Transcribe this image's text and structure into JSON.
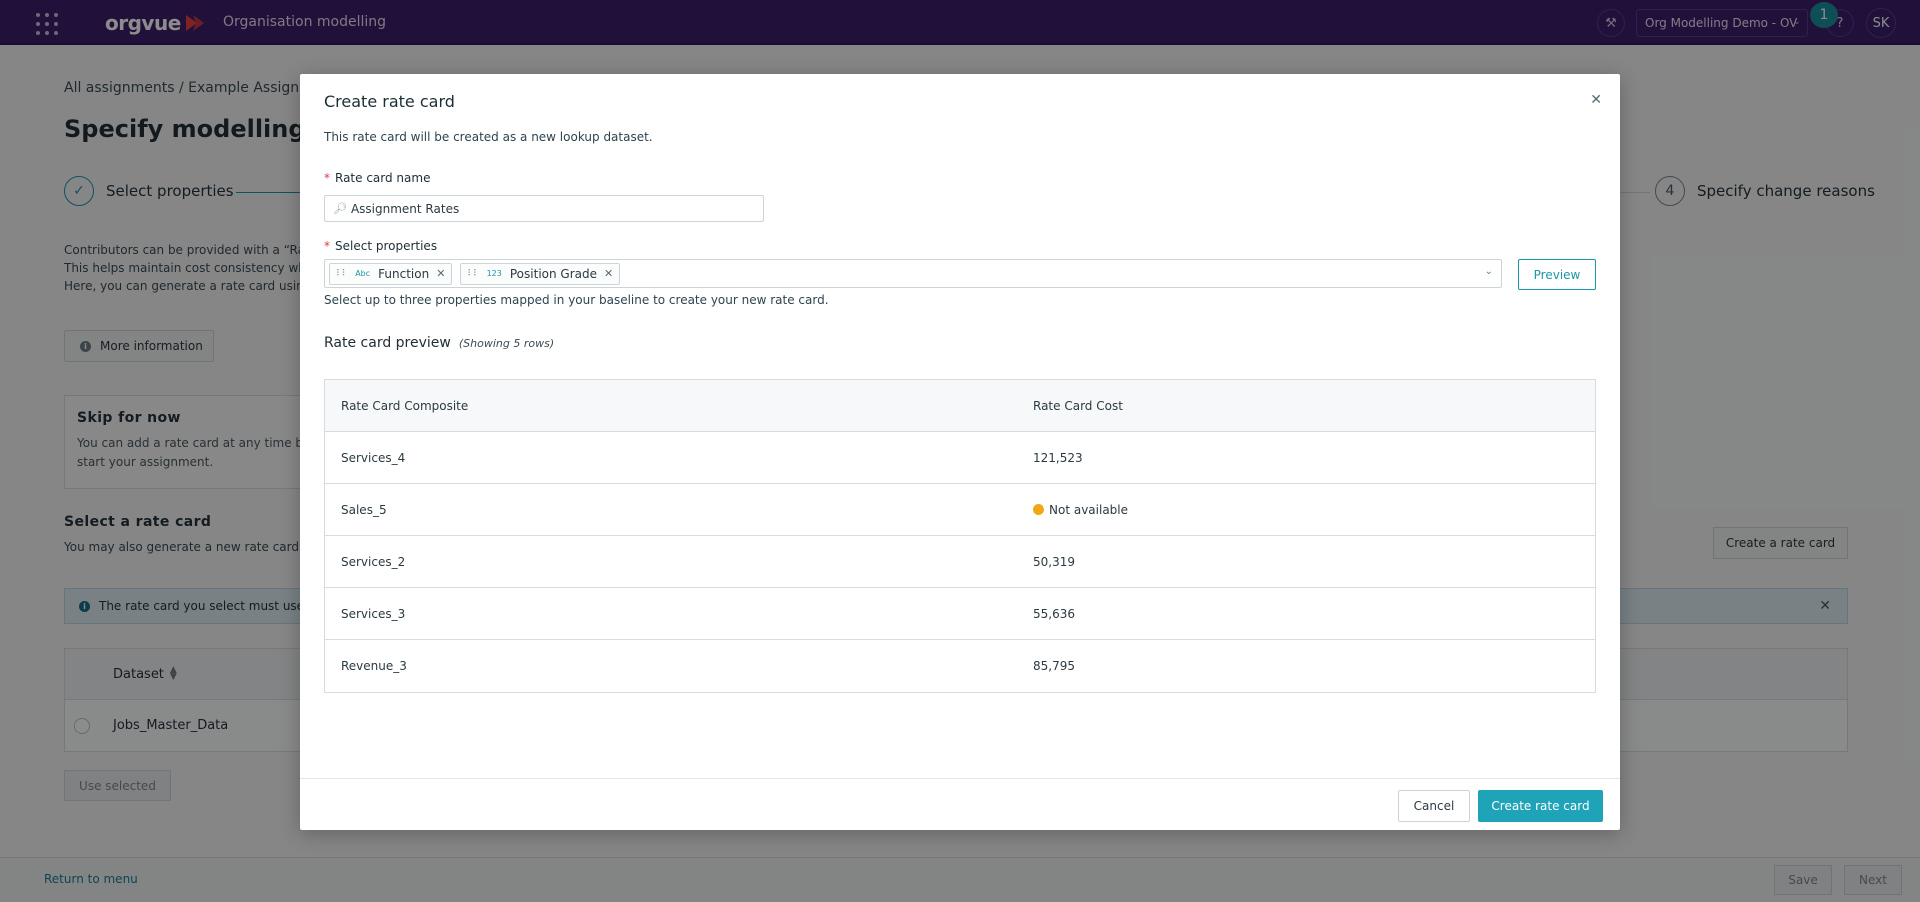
{
  "topbar": {
    "logo_text": "orgvue",
    "app_title": "Organisation modelling",
    "dataset_selector": "Org Modelling Demo - OV",
    "notification_count": "1",
    "help_label": "?",
    "user_initials": "SK",
    "accent_color": "#3d1f6b"
  },
  "page": {
    "breadcrumb": "All assignments / Example Assignm",
    "title": "Specify modelling p",
    "step1_label": "Select properties",
    "step4_number": "4",
    "step4_label": "Specify change reasons",
    "intro_lines": [
      "Contributors can be provided with a “Rate",
      "This helps maintain cost consistency whe",
      "Here, you can generate a rate card using"
    ],
    "more_info_label": "More information",
    "skip_title": "Skip for now",
    "skip_text_1": "You can add a rate card at any time bef",
    "skip_text_2": "start your assignment.",
    "select_rc_title": "Select a rate card",
    "select_rc_sub": "You may also generate a new rate card fr",
    "create_rc_label": "Create a rate card",
    "notice_text": "The rate card you select must use",
    "dataset_col": "Dataset",
    "dataset_row": "Jobs_Master_Data",
    "use_selected_label": "Use selected"
  },
  "footer": {
    "return_label": "Return to menu",
    "save_label": "Save",
    "next_label": "Next"
  },
  "modal": {
    "title": "Create rate card",
    "description": "This rate card will be created as a new lookup dataset.",
    "name_label": "Rate card name",
    "name_value": "Assignment Rates",
    "props_label": "Select properties",
    "chips": [
      {
        "type": "Abc",
        "label": "Function"
      },
      {
        "type": "123",
        "label": "Position Grade"
      }
    ],
    "preview_label": "Preview",
    "props_help": "Select up to three properties mapped in your baseline to create your new rate card.",
    "preview_heading": "Rate card preview",
    "preview_count": "(Showing 5 rows)",
    "table": {
      "col1": "Rate Card Composite",
      "col2": "Rate Card Cost",
      "rows": [
        {
          "composite": "Services_4",
          "cost": "121,523"
        },
        {
          "composite": "Sales_5",
          "cost": "Not available"
        },
        {
          "composite": "Services_2",
          "cost": "50,319"
        },
        {
          "composite": "Services_3",
          "cost": "55,636"
        },
        {
          "composite": "Revenue_3",
          "cost": "85,795"
        }
      ]
    },
    "cancel_label": "Cancel",
    "create_label": "Create rate card",
    "primary_color": "#1fa3b9",
    "warning_color": "#f2a714"
  }
}
